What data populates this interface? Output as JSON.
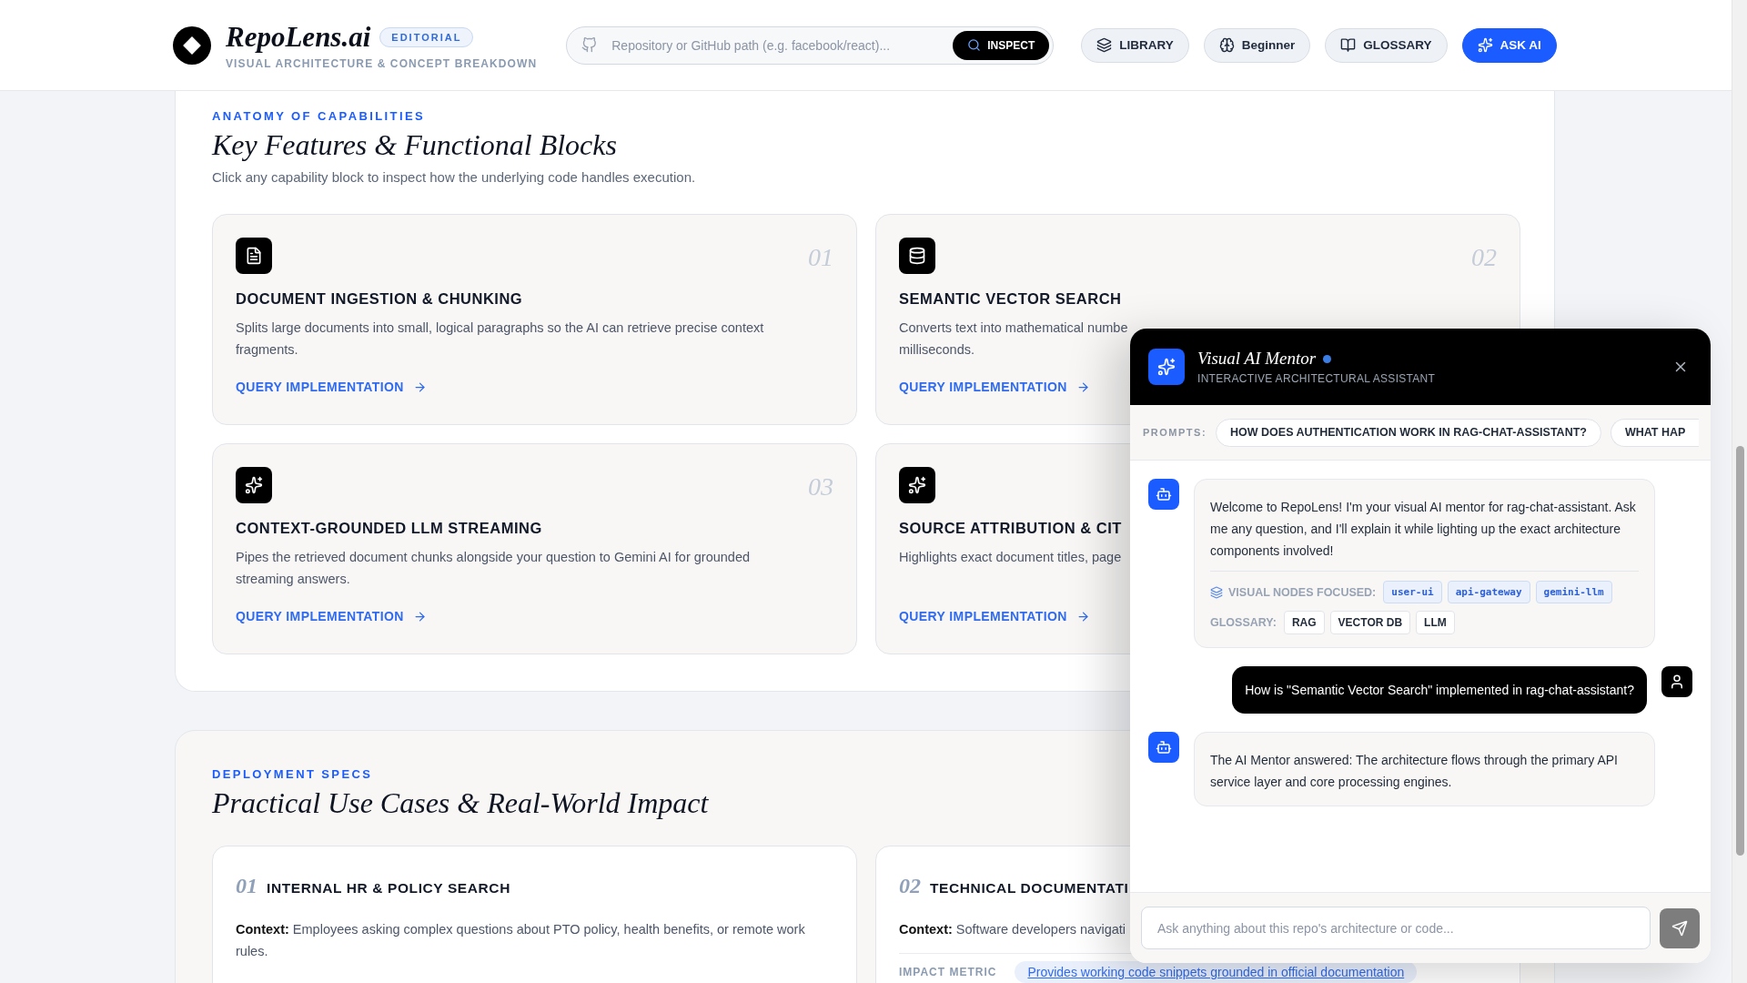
{
  "header": {
    "logo_text": "RepoLens.ai",
    "badge": "EDITORIAL",
    "subtitle": "VISUAL ARCHITECTURE & CONCEPT BREAKDOWN",
    "search": {
      "placeholder": "Repository or GitHub path (e.g. facebook/react)...",
      "button": "INSPECT"
    },
    "nav": [
      {
        "label": "LIBRARY",
        "kind": "library",
        "selected": false
      },
      {
        "label": "Beginner",
        "kind": "level",
        "selected": false
      },
      {
        "label": "GLOSSARY",
        "kind": "glossary",
        "selected": false
      },
      {
        "label": "ASK AI",
        "kind": "ai",
        "selected": true
      }
    ]
  },
  "features": {
    "eyebrow": "ANATOMY OF CAPABILITIES",
    "title": "Key Features & Functional Blocks",
    "subtitle": "Click any capability block to inspect how the underlying code handles execution.",
    "cards": [
      {
        "kind": "document",
        "number": "01",
        "title": "DOCUMENT INGESTION & CHUNKING",
        "description_lines": [
          "Splits large documents into small, logical paragraphs so the AI can retrieve precise context",
          "fragments."
        ],
        "link": "QUERY IMPLEMENTATION"
      },
      {
        "kind": "database",
        "number": "02",
        "title": "SEMANTIC VECTOR SEARCH",
        "description_lines": [
          "Converts text into mathematical numbe",
          "milliseconds."
        ],
        "link": "QUERY IMPLEMENTATION"
      },
      {
        "kind": "sparkles",
        "number": "03",
        "title": "CONTEXT-GROUNDED LLM STREAMING",
        "description_lines": [
          "Pipes the retrieved document chunks alongside your question to Gemini AI for grounded",
          "streaming answers."
        ],
        "link": "QUERY IMPLEMENTATION"
      },
      {
        "kind": "sparkles",
        "title": "SOURCE ATTRIBUTION & CIT",
        "description_lines": [
          "Highlights exact document titles, page"
        ],
        "link": "QUERY IMPLEMENTATION"
      }
    ]
  },
  "use_cases": {
    "eyebrow": "DEPLOYMENT SPECS",
    "title": "Practical Use Cases & Real-World Impact",
    "cards": [
      {
        "number": "01",
        "title": "INTERNAL HR & POLICY SEARCH",
        "context_label": "Context:",
        "context": "Employees asking complex questions about PTO policy, health benefits, or remote work rules."
      },
      {
        "number": "02",
        "title": "TECHNICAL DOCUMENTATI",
        "context_label": "Context:",
        "context": "Software developers navigati",
        "impact_label": "IMPACT METRIC",
        "impact": "Provides working code snippets grounded in official documentation"
      }
    ]
  },
  "chat": {
    "title": "Visual AI Mentor",
    "online": true,
    "subtitle": "INTERACTIVE ARCHITECTURAL ASSISTANT",
    "prompts_label": "PROMPTS:",
    "prompts": [
      "HOW DOES AUTHENTICATION WORK IN RAG-CHAT-ASSISTANT?",
      "WHAT HAP"
    ],
    "messages": [
      {
        "kind": "bot",
        "text": "Welcome to RepoLens! I'm your visual AI mentor for rag-chat-assistant. Ask me any question, and I'll explain it while lighting up the exact architecture components involved!",
        "nodes_label": "VISUAL NODES FOCUSED:",
        "nodes": [
          "user-ui",
          "api-gateway",
          "gemini-llm"
        ],
        "glossary_label": "GLOSSARY:",
        "glossary": [
          "RAG",
          "VECTOR DB",
          "LLM"
        ]
      },
      {
        "kind": "user",
        "text": "How is \"Semantic Vector Search\" implemented in rag-chat-assistant?"
      },
      {
        "kind": "bot",
        "text": "The AI Mentor answered: The architecture flows through the primary API service layer and core processing engines."
      }
    ],
    "input": {
      "placeholder": "Ask anything about this repo's architecture or code..."
    }
  }
}
